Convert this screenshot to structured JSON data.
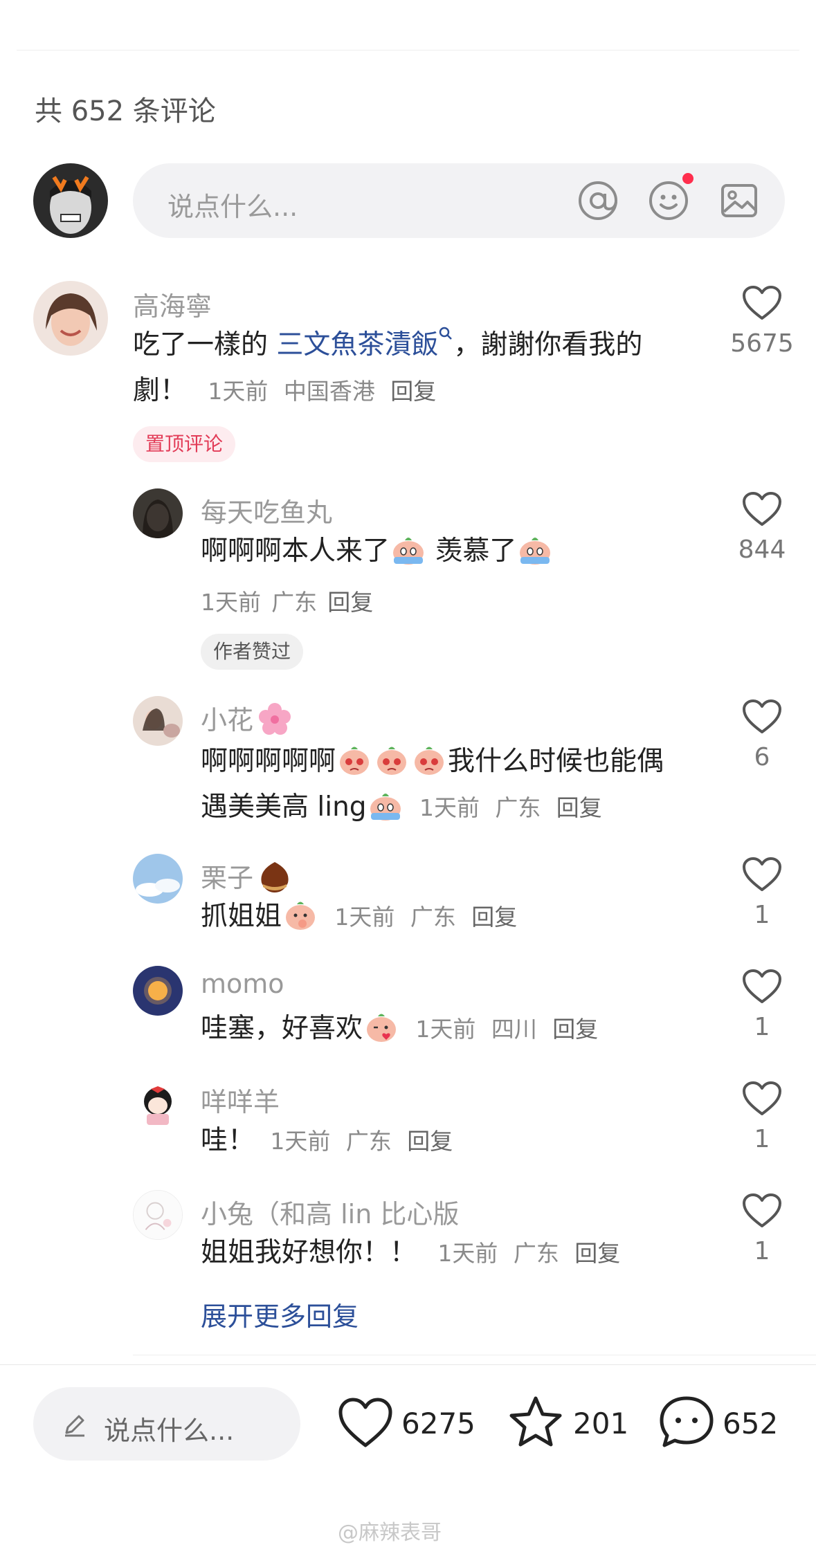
{
  "header": {
    "comment_count_text": "共 652 条评论"
  },
  "comment_input": {
    "placeholder": "说点什么..."
  },
  "comments": [
    {
      "author": "高海寧",
      "text_line1_a": "吃了一樣的 ",
      "text_link": "三文魚茶漬飯",
      "text_line1_b": "，謝謝你看我的",
      "text_line2": "劇！",
      "time": "1天前",
      "location": "中国香港",
      "reply": "回复",
      "likes": "5675",
      "badge": "置顶评论"
    }
  ],
  "replies": [
    {
      "author": "每天吃鱼丸",
      "text_a": "啊啊啊本人来了",
      "text_b": " 羡慕了",
      "time": "1天前",
      "location": "广东",
      "reply": "回复",
      "likes": "844",
      "badge": "作者赞过"
    },
    {
      "author": "小花",
      "text_a": "啊啊啊啊啊",
      "text_b": "我什么时候也能偶",
      "text_c": "遇美美高 ling",
      "time": "1天前",
      "location": "广东",
      "reply": "回复",
      "likes": "6"
    },
    {
      "author": "栗子",
      "text_a": "抓姐姐",
      "time": "1天前",
      "location": "广东",
      "reply": "回复",
      "likes": "1"
    },
    {
      "author": "momo",
      "text_a": "哇塞，好喜欢",
      "time": "1天前",
      "location": "四川",
      "reply": "回复",
      "likes": "1"
    },
    {
      "author": "咩咩羊",
      "text_a": "哇！",
      "time": "1天前",
      "location": "广东",
      "reply": "回复",
      "likes": "1"
    },
    {
      "author": "小兔（和高 lin 比心版",
      "text_a": "姐姐我好想你！！",
      "time": "1天前",
      "location": "广东",
      "reply": "回复",
      "likes": "1"
    }
  ],
  "expand_more": "展开更多回复",
  "bottom_bar": {
    "input_label": "说点什么...",
    "likes": "6275",
    "favorites": "201",
    "comments": "652"
  },
  "watermark": "@麻辣表哥",
  "icons": {
    "mention": "at-icon",
    "emoji": "smile-icon",
    "image": "image-icon",
    "like": "heart-icon",
    "favorite": "star-icon",
    "comment": "chat-bubble-icon",
    "edit": "pencil-icon",
    "search_hint": "search-icon"
  },
  "colors": {
    "accent_link": "#2c4f99",
    "pin_badge": "#e23b57",
    "notification_dot": "#ff2e4d"
  }
}
